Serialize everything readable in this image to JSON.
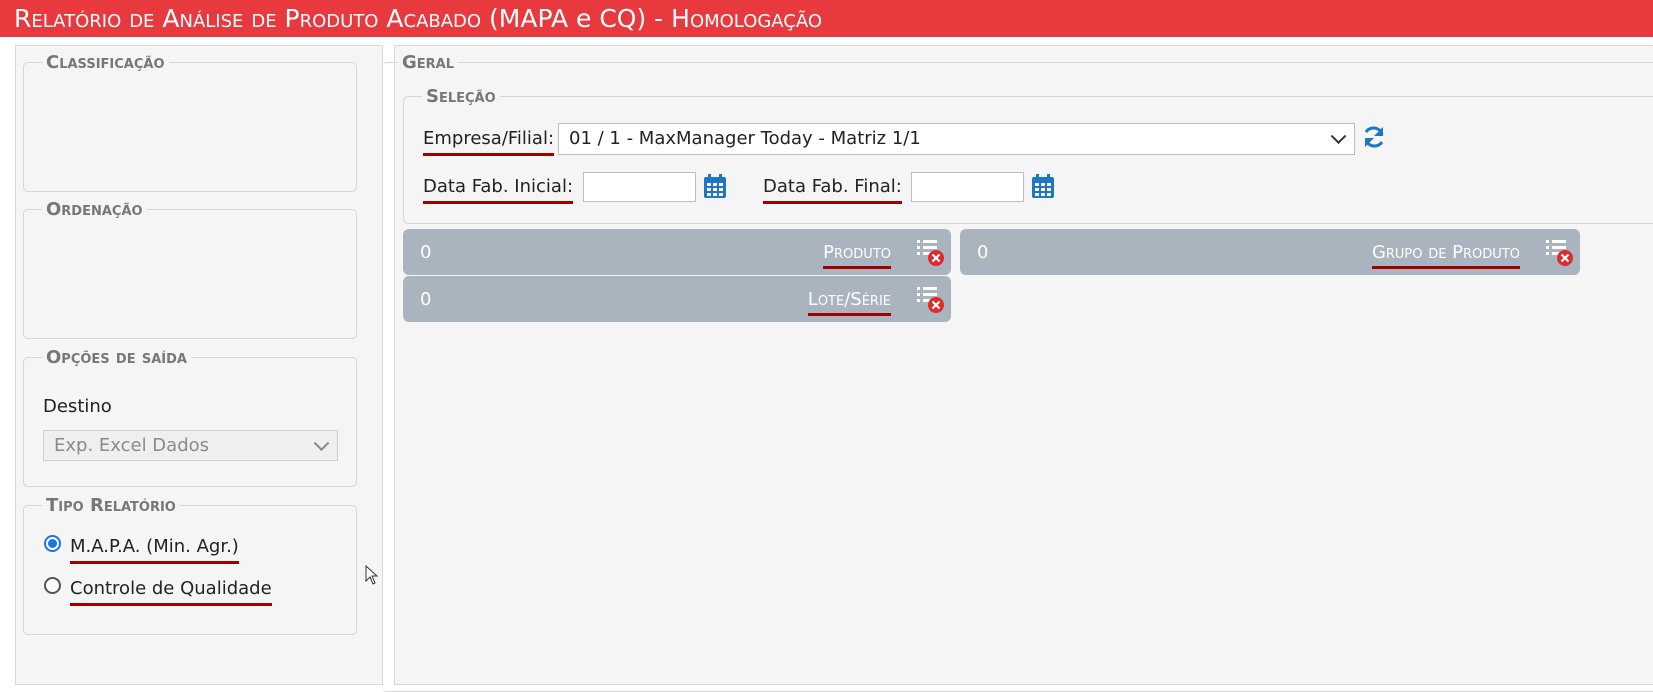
{
  "window": {
    "title": "Relatório de Análise de Produto Acabado",
    "title_suffix": "(MAPA e CQ)",
    "environment": "- Homologação"
  },
  "left": {
    "classificacao": {
      "legend": "Classificação"
    },
    "ordenacao": {
      "legend": "Ordenação"
    },
    "opcoes_saida": {
      "legend": "Opções de saída",
      "destino_label": "Destino",
      "destino_value": "Exp. Excel Dados"
    },
    "tipo_relatorio": {
      "legend": "Tipo Relatório",
      "options": [
        {
          "label": "M.A.P.A. (Min. Agr.)",
          "checked": true
        },
        {
          "label": "Controle de Qualidade",
          "checked": false
        }
      ]
    }
  },
  "right": {
    "geral_legend": "Geral",
    "selecao": {
      "legend": "Seleção",
      "empresa_label": "Empresa/Filial:",
      "empresa_value": "01 / 1 - MaxManager Today - Matriz 1/1",
      "data_inicial_label": "Data Fab. Inicial:",
      "data_inicial_value": "",
      "data_final_label": "Data Fab. Final:",
      "data_final_value": ""
    },
    "filters": [
      {
        "count": "0",
        "label": "Produto"
      },
      {
        "count": "0",
        "label": "Grupo de Produto"
      },
      {
        "count": "0",
        "label": "Lote/Série"
      }
    ]
  },
  "colors": {
    "title_bar": "#e8393f",
    "filter_bar": "#aab4be",
    "accent_blue": "#1a73e8",
    "underline": "#a00000"
  },
  "icons": {
    "refresh": "refresh-icon",
    "calendar": "calendar-icon",
    "clear_filter": "clear-filter-icon"
  }
}
